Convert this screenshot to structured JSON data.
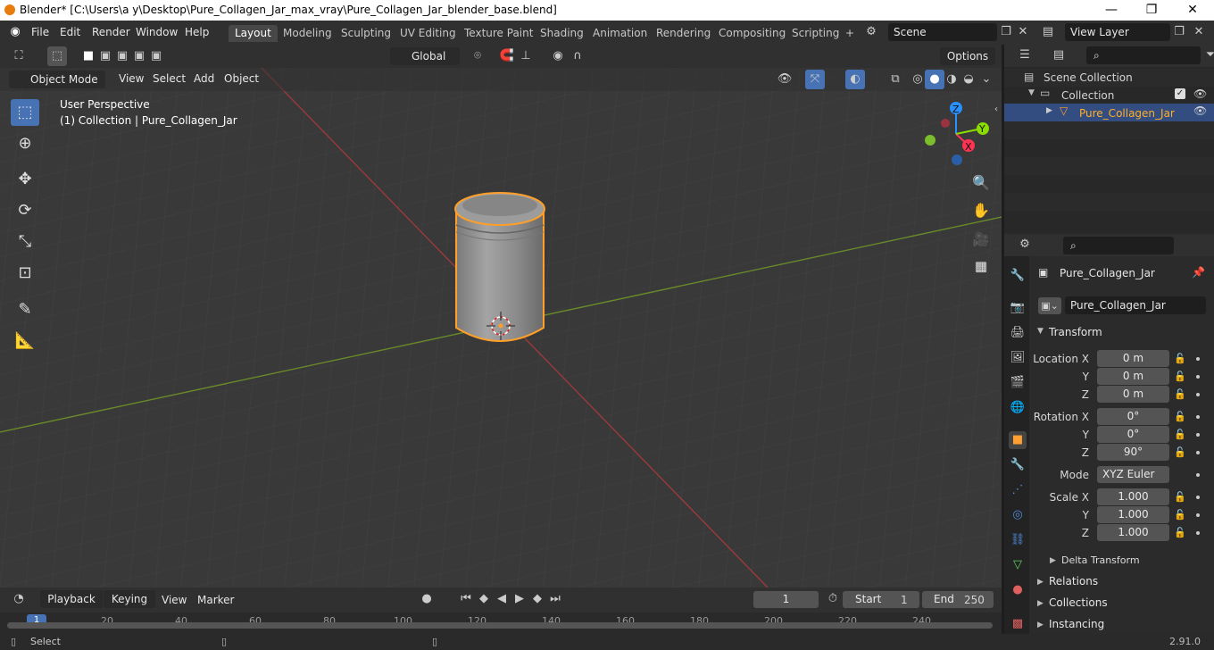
{
  "window": {
    "title": "Blender* [C:\\Users\\a y\\Desktop\\Pure_Collagen_Jar_max_vray\\Pure_Collagen_Jar_blender_base.blend]",
    "min": "—",
    "max": "❐",
    "close": "✕"
  },
  "menu": [
    "File",
    "Edit",
    "Render",
    "Window",
    "Help"
  ],
  "workspaces": [
    "Layout",
    "Modeling",
    "Sculpting",
    "UV Editing",
    "Texture Paint",
    "Shading",
    "Animation",
    "Rendering",
    "Compositing",
    "Scripting"
  ],
  "add_workspace": "+",
  "scene": "Scene",
  "view_layer": "View Layer",
  "toolheader": {
    "orientation": "Global",
    "options": "Options"
  },
  "viewport_header": {
    "mode": "Object Mode",
    "menus": [
      "View",
      "Select",
      "Add",
      "Object"
    ]
  },
  "viewport": {
    "perspective": "User Perspective",
    "collection_info": "(1) Collection | Pure_Collagen_Jar"
  },
  "gizmo": {
    "x": "X",
    "y": "Y",
    "z": "Z"
  },
  "outliner": {
    "scene_collection": "Scene Collection",
    "collection": "Collection",
    "object": "Pure_Collagen_Jar"
  },
  "properties": {
    "object_name": "Pure_Collagen_Jar",
    "datablock": "Pure_Collagen_Jar",
    "transform": "Transform",
    "location": {
      "label": "Location X",
      "y": "Y",
      "z": "Z",
      "vx": "0 m",
      "vy": "0 m",
      "vz": "0 m"
    },
    "rotation": {
      "label": "Rotation X",
      "y": "Y",
      "z": "Z",
      "vx": "0°",
      "vy": "0°",
      "vz": "90°"
    },
    "mode": {
      "label": "Mode",
      "value": "XYZ Euler"
    },
    "scale": {
      "label": "Scale X",
      "y": "Y",
      "z": "Z",
      "vx": "1.000",
      "vy": "1.000",
      "vz": "1.000"
    },
    "delta": "Delta Transform",
    "panels": [
      "Relations",
      "Collections",
      "Instancing"
    ]
  },
  "timeline": {
    "menus": [
      "Playback",
      "Keying",
      "View",
      "Marker"
    ],
    "frame": "1",
    "start_label": "Start",
    "start": "1",
    "end_label": "End",
    "end": "250",
    "ticks": [
      "20",
      "40",
      "60",
      "80",
      "100",
      "120",
      "140",
      "160",
      "180",
      "200",
      "220",
      "240"
    ],
    "current": "1"
  },
  "status": {
    "select": "Select",
    "version": "2.91.0"
  },
  "colors": {
    "accent": "#4772b3",
    "selection": "#ffa031",
    "x_axis": "#ff3352",
    "y_axis": "#8bdc00",
    "z_axis": "#2890ff"
  }
}
